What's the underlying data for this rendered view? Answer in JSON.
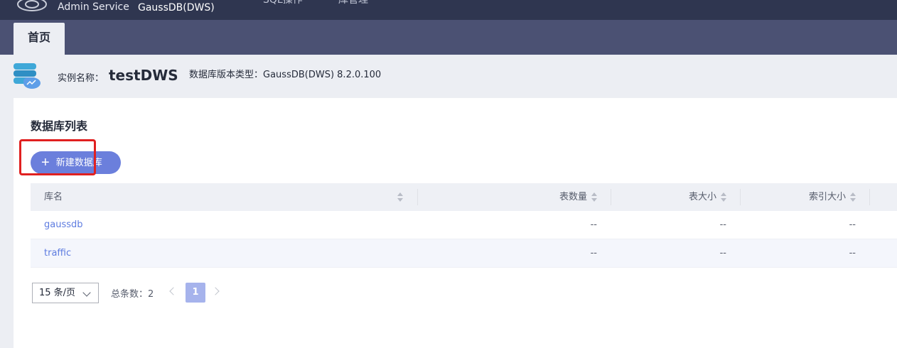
{
  "topbar": {
    "brand": "Admin Service",
    "service": "GaussDB(DWS)",
    "nav": [
      "SQL操作",
      "库管理"
    ]
  },
  "tabs": [
    {
      "label": "首页"
    }
  ],
  "instance": {
    "name_label": "实例名称：",
    "name": "testDWS",
    "version_label": "数据库版本类型：",
    "version": "GaussDB(DWS) 8.2.0.100"
  },
  "section": {
    "title": "数据库列表",
    "new_button": "新建数据库"
  },
  "table": {
    "columns": [
      "库名",
      "表数量",
      "表大小",
      "索引大小"
    ],
    "rows": [
      {
        "name": "gaussdb",
        "tables": "--",
        "table_size": "--",
        "index_size": "--"
      },
      {
        "name": "traffic",
        "tables": "--",
        "table_size": "--",
        "index_size": "--"
      }
    ]
  },
  "pagination": {
    "page_size": "15 条/页",
    "total_label": "总条数：",
    "total": "2",
    "current_page": "1"
  },
  "colors": {
    "topbar": "#2f3650",
    "tabbar": "#4b5173",
    "accent": "#6b7fdc",
    "link": "#5e7ce0",
    "highlight": "#e02020"
  },
  "icons": [
    "database-cloud-icon",
    "plus-icon",
    "sort-icon",
    "chevron-down-icon",
    "chevron-left-icon",
    "chevron-right-icon"
  ]
}
